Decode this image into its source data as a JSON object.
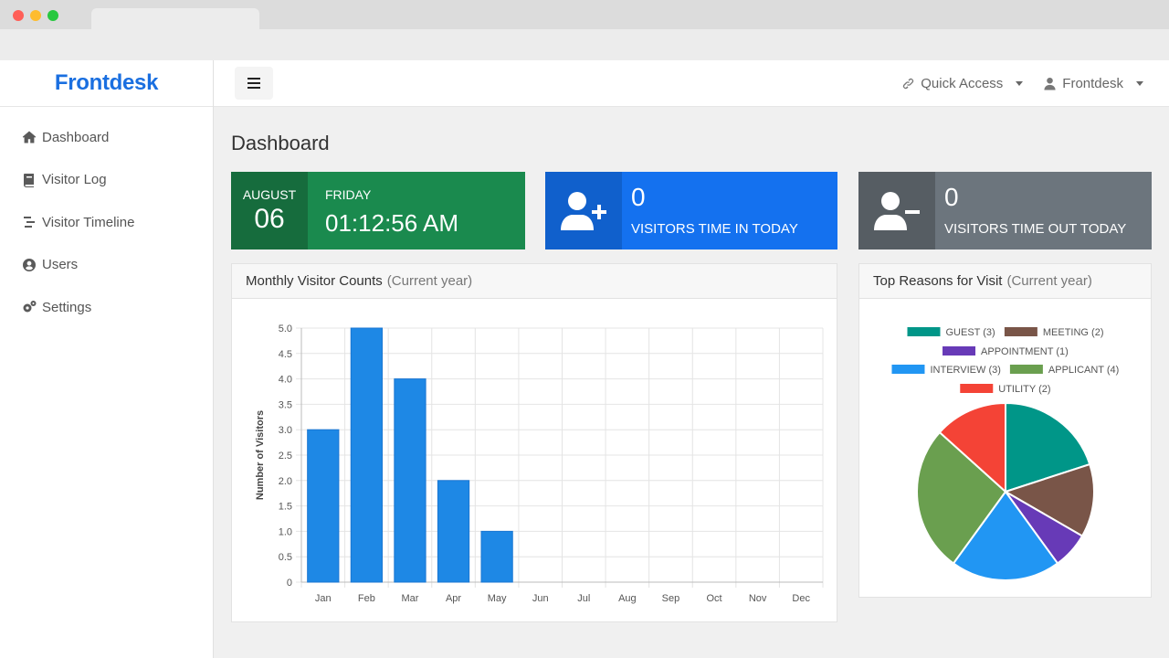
{
  "app": {
    "brand": "Frontdesk"
  },
  "sidebar": {
    "items": [
      {
        "label": "Dashboard",
        "icon": "home-icon"
      },
      {
        "label": "Visitor Log",
        "icon": "book-icon"
      },
      {
        "label": "Visitor Timeline",
        "icon": "timeline-icon"
      },
      {
        "label": "Users",
        "icon": "user-circle-icon"
      },
      {
        "label": "Settings",
        "icon": "gears-icon"
      }
    ]
  },
  "topbar": {
    "quick_access": "Quick Access",
    "user": "Frontdesk"
  },
  "page": {
    "title": "Dashboard"
  },
  "cards": {
    "date": {
      "month": "AUGUST",
      "day": "06",
      "weekday": "FRIDAY",
      "time": "01:12:56 AM"
    },
    "time_in": {
      "count": "0",
      "label": "VISITORS TIME IN TODAY"
    },
    "time_out": {
      "count": "0",
      "label": "VISITORS TIME OUT TODAY"
    }
  },
  "panels": {
    "monthly": {
      "title": "Monthly Visitor Counts",
      "subtitle": "(Current year)"
    },
    "reasons": {
      "title": "Top Reasons for Visit",
      "subtitle": "(Current year)"
    }
  },
  "colors": {
    "brand": "#1a6fe0",
    "bar": "#1e88e5",
    "card_green": "#1a8a4e",
    "card_blue": "#1471ef",
    "card_gray": "#6c757d"
  },
  "chart_data": [
    {
      "type": "bar",
      "categories": [
        "Jan",
        "Feb",
        "Mar",
        "Apr",
        "May",
        "Jun",
        "Jul",
        "Aug",
        "Sep",
        "Oct",
        "Nov",
        "Dec"
      ],
      "values": [
        3,
        5,
        4,
        2,
        1,
        0,
        0,
        0,
        0,
        0,
        0,
        0
      ],
      "ylabel": "Number of Visitors",
      "ylim": [
        0,
        5
      ],
      "yticks": [
        "0",
        "0.5",
        "1.0",
        "1.5",
        "2.0",
        "2.5",
        "3.0",
        "3.5",
        "4.0",
        "4.5",
        "5.0"
      ],
      "grid": true
    },
    {
      "type": "pie",
      "legend": "top",
      "slices": [
        {
          "label": "GUEST (3)",
          "value": 3,
          "color": "#009688"
        },
        {
          "label": "MEETING (2)",
          "value": 2,
          "color": "#795548"
        },
        {
          "label": "APPOINTMENT (1)",
          "value": 1,
          "color": "#673ab7"
        },
        {
          "label": "INTERVIEW (3)",
          "value": 3,
          "color": "#2196f3"
        },
        {
          "label": "APPLICANT (4)",
          "value": 4,
          "color": "#6a9f4f"
        },
        {
          "label": "UTILITY (2)",
          "value": 2,
          "color": "#f44336"
        }
      ]
    }
  ]
}
